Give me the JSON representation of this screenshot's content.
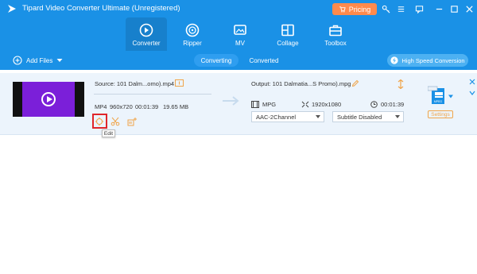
{
  "titlebar": {
    "title": "Tipard Video Converter Ultimate (Unregistered)",
    "pricing_label": "Pricing",
    "icons": [
      "key-icon",
      "menu-icon",
      "feedback-icon",
      "minimize-icon",
      "maximize-icon",
      "close-icon"
    ]
  },
  "nav": {
    "tabs": [
      {
        "label": "Converter",
        "icon": "converter-icon",
        "active": true
      },
      {
        "label": "Ripper",
        "icon": "ripper-icon",
        "active": false
      },
      {
        "label": "MV",
        "icon": "mv-icon",
        "active": false
      },
      {
        "label": "Collage",
        "icon": "collage-icon",
        "active": false
      },
      {
        "label": "Toolbox",
        "icon": "toolbox-icon",
        "active": false
      }
    ]
  },
  "toolbar": {
    "add_files_label": "Add Files",
    "seg_converting": "Converting",
    "seg_converted": "Converted",
    "high_speed_label": "High Speed Conversion"
  },
  "file": {
    "source": "Source: 101 Dalm...omo).mp4",
    "format": "MP4",
    "resolution": "960x720",
    "duration": "00:01:39",
    "size": "19.65 MB",
    "output": "Output: 101 Dalmatia...S Promo).mpg",
    "out_format": "MPG",
    "out_resolution": "1920x1080",
    "out_duration": "00:01:39",
    "audio_track": "AAC-2Channel",
    "subtitle": "Subtitle Disabled",
    "format_badge_text": "MPEG",
    "settings_label": "Settings",
    "tooltip": "Edit"
  },
  "colors": {
    "brand_blue": "#1a91e6",
    "pricing_orange": "#ff8a4c",
    "video_purple": "#7b1fd9",
    "highlight_red": "#e0262a"
  }
}
